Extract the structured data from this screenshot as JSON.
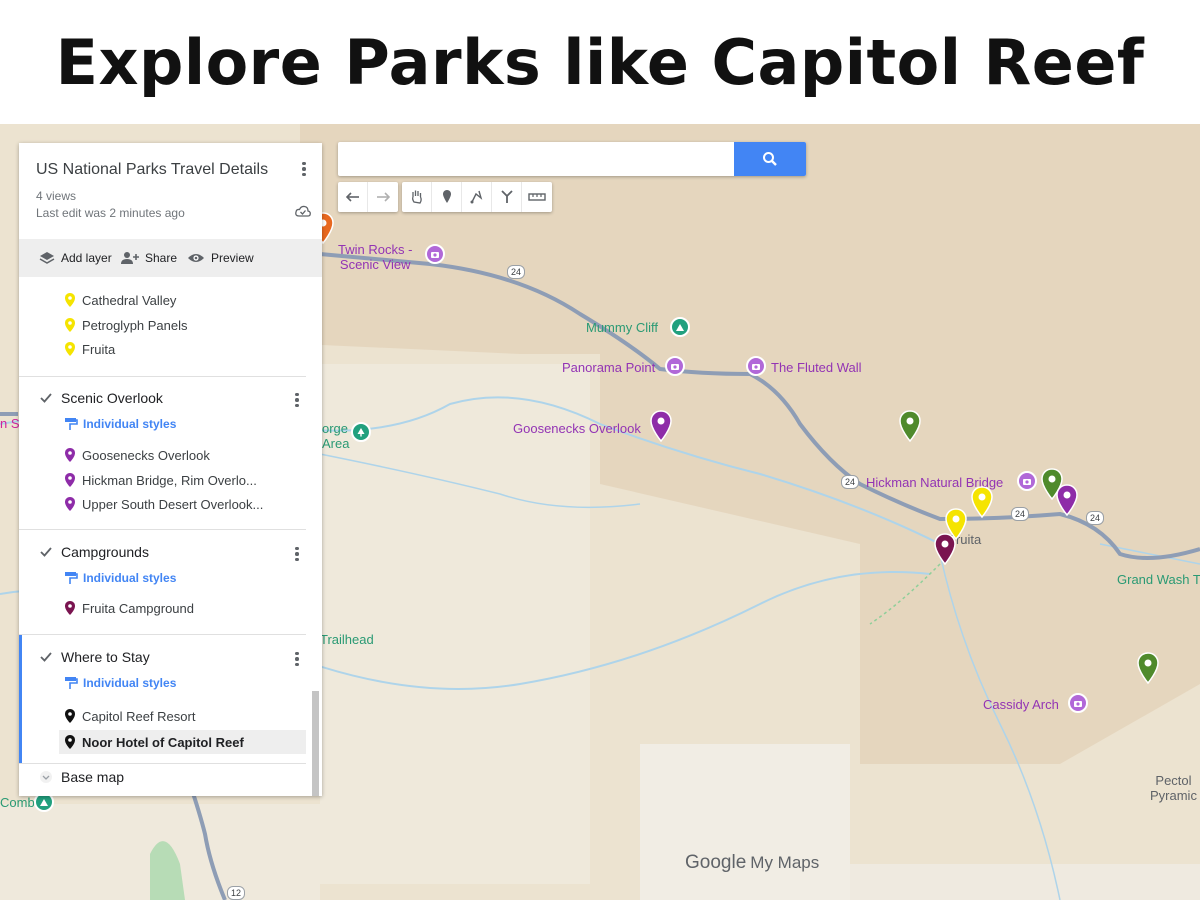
{
  "headline": "Explore Parks like Capitol Reef",
  "panel": {
    "title": "US National Parks Travel Details",
    "views": "4 views",
    "last_edit": "Last edit was 2 minutes ago",
    "actions": {
      "add_layer": "Add layer",
      "share": "Share",
      "preview": "Preview"
    },
    "top_items": [
      "Cathedral Valley",
      "Petroglyph Panels",
      "Fruita"
    ],
    "layers": [
      {
        "title": "Scenic Overlook",
        "style": "Individual styles",
        "items": [
          "Goosenecks Overlook",
          "Hickman Bridge, Rim Overlo...",
          "Upper South Desert Overlook..."
        ]
      },
      {
        "title": "Campgrounds",
        "style": "Individual styles",
        "items": [
          "Fruita Campground"
        ]
      },
      {
        "title": "Where to Stay",
        "style": "Individual styles",
        "items": [
          "Capitol Reef Resort",
          "Noor Hotel of Capitol Reef"
        ]
      }
    ],
    "base_map": "Base map"
  },
  "search": {
    "value": ""
  },
  "map_labels": {
    "twin_rocks_1": "Twin Rocks -",
    "twin_rocks_2": "Scenic View",
    "mummy_cliff": "Mummy Cliff",
    "panorama_point": "Panorama Point",
    "fluted_wall": "The Fluted Wall",
    "goosenecks_overlook": "Goosenecks Overlook",
    "hickman_natural_bridge": "Hickman Natural Bridge",
    "fruita": "Fruita",
    "grand_wash": "Grand Wash T",
    "cassidy_arch": "Cassidy Arch",
    "trailhead": "Trailhead",
    "george_1": "orge",
    "george_2": "Area",
    "spring_fragment": "n Sp",
    "comb_fragment": "Comb",
    "pectol_1": "Pectol",
    "pectol_2": "Pyramic",
    "route_24": "24",
    "route_12": "12"
  },
  "colors": {
    "pin_yellow": "#f5e400",
    "pin_purple": "#8e2ca8",
    "pin_maroon": "#7a1450",
    "pin_green": "#4f8a2c",
    "pin_black": "#111111",
    "pin_orange": "#e8681f",
    "accent": "#4285f4"
  },
  "branding": {
    "google": "Google",
    "my_maps": "My Maps"
  }
}
